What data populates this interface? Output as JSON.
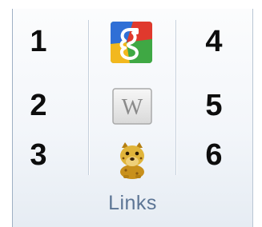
{
  "links_group": {
    "label": "Links",
    "left_column": [
      "1",
      "2",
      "3"
    ],
    "right_column": [
      "4",
      "5",
      "6"
    ],
    "icons": [
      {
        "name": "google-icon",
        "glyph": "g"
      },
      {
        "name": "wikipedia-icon",
        "glyph": "W"
      },
      {
        "name": "dog-icon",
        "glyph": ""
      }
    ]
  }
}
